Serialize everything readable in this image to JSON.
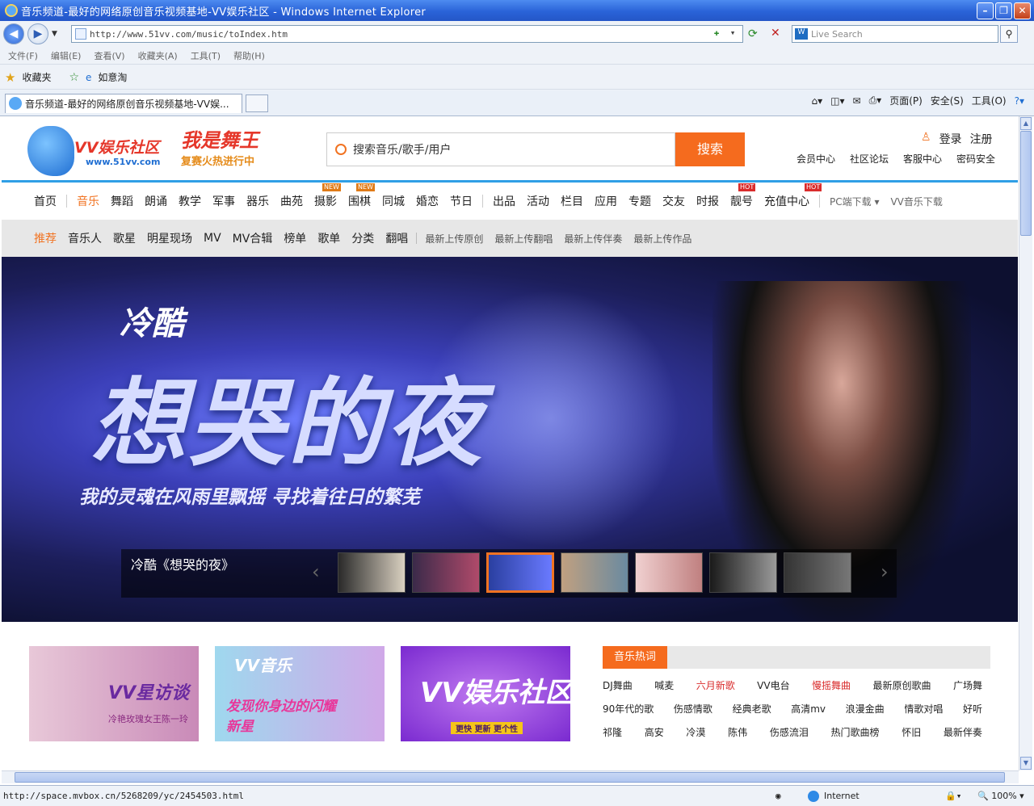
{
  "window": {
    "title": "音乐频道-最好的网络原创音乐视频基地-VV娱乐社区 - Windows Internet Explorer"
  },
  "browser": {
    "url": "http://www.51vv.com/music/toIndex.htm",
    "search_placeholder": "Live Search",
    "menu": [
      "文件(F)",
      "编辑(E)",
      "查看(V)",
      "收藏夹(A)",
      "工具(T)",
      "帮助(H)"
    ],
    "favorites_label": "收藏夹",
    "favorites_item": "如意淘",
    "tab_title": "音乐频道-最好的网络原创音乐视频基地-VV娱...",
    "commands": [
      "页面(P)",
      "安全(S)",
      "工具(O)"
    ],
    "status_url": "http://space.mvbox.cn/5268209/yc/2454503.html",
    "zone": "Internet",
    "zoom": "100%"
  },
  "site": {
    "logo_brand": "VV娱乐社区",
    "logo_domain": "www.51vv.com",
    "promo_title": "我是舞王",
    "promo_sub": "复赛火热进行中",
    "search_placeholder": "搜索音乐/歌手/用户",
    "search_button": "搜索",
    "login": "登录",
    "register": "注册",
    "toplinks": [
      "会员中心",
      "社区论坛",
      "客服中心",
      "密码安全"
    ],
    "mainnav": [
      "首页",
      "音乐",
      "舞蹈",
      "朗诵",
      "教学",
      "军事",
      "器乐",
      "曲苑",
      "摄影",
      "围棋",
      "同城",
      "婚恋",
      "节日",
      "出品",
      "活动",
      "栏目",
      "应用",
      "专题",
      "交友",
      "时报",
      "靓号",
      "充值中心"
    ],
    "nav_badges": {
      "new": "NEW",
      "hot": "HOT"
    },
    "pc_download": "PC端下载",
    "vv_download": "VV音乐下载",
    "subnav": [
      "推荐",
      "音乐人",
      "歌星",
      "明星现场",
      "MV",
      "MV合辑",
      "榜单",
      "歌单",
      "分类",
      "翻唱"
    ],
    "subnav_small": [
      "最新上传原创",
      "最新上传翻唱",
      "最新上传伴奏",
      "最新上传作品"
    ],
    "banner": {
      "artist": "冷酷",
      "song": "想哭的夜",
      "lyric": "我的灵魂在风雨里飘摇 寻找着往日的繁芜",
      "caption": "冷酷《想哭的夜》"
    },
    "cards": [
      {
        "title": "VV星访谈",
        "sub": "冷艳玫瑰女王陈一玲"
      },
      {
        "title": "VV音乐",
        "sub": "发现你身边的闪耀新星"
      },
      {
        "title": "VV娱乐社区",
        "sub": "更快 更新 更个性"
      }
    ],
    "hotwords_title": "音乐热词",
    "hotwords": [
      [
        "DJ舞曲",
        "喊麦",
        "六月新歌",
        "VV电台",
        "慢摇舞曲",
        "最新原创歌曲",
        "广场舞"
      ],
      [
        "90年代的歌",
        "伤感情歌",
        "经典老歌",
        "高清mv",
        "浪漫金曲",
        "情歌对唱",
        "好听"
      ],
      [
        "祁隆",
        "高安",
        "冷漠",
        "陈伟",
        "伤感流泪",
        "热门歌曲榜",
        "怀旧",
        "最新伴奏"
      ]
    ],
    "accent": "#f56b1e"
  }
}
